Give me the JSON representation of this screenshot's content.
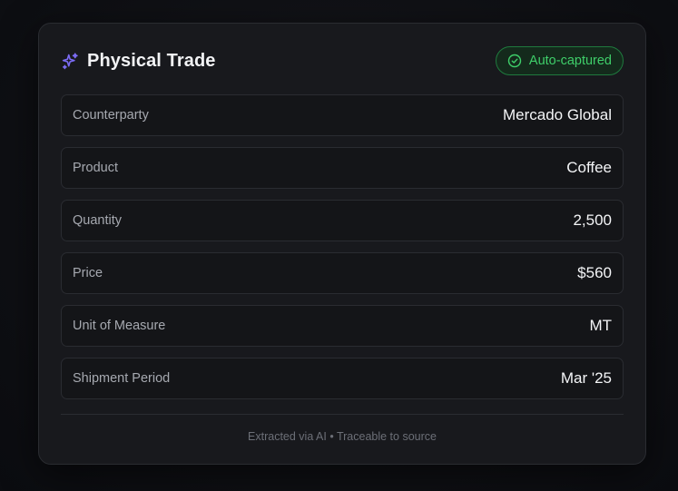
{
  "card": {
    "title": "Physical Trade",
    "title_icon": "sparkles-icon",
    "badge": {
      "label": "Auto-captured",
      "icon": "check-circle-icon",
      "color": "#3fcf6a"
    },
    "accent_color": "#7c6cf6",
    "fields": [
      {
        "label": "Counterparty",
        "value": "Mercado Global"
      },
      {
        "label": "Product",
        "value": "Coffee"
      },
      {
        "label": "Quantity",
        "value": "2,500"
      },
      {
        "label": "Price",
        "value": "$560"
      },
      {
        "label": "Unit of Measure",
        "value": "MT"
      },
      {
        "label": "Shipment Period",
        "value": "Mar '25"
      }
    ],
    "footer": "Extracted via AI • Traceable to source"
  }
}
